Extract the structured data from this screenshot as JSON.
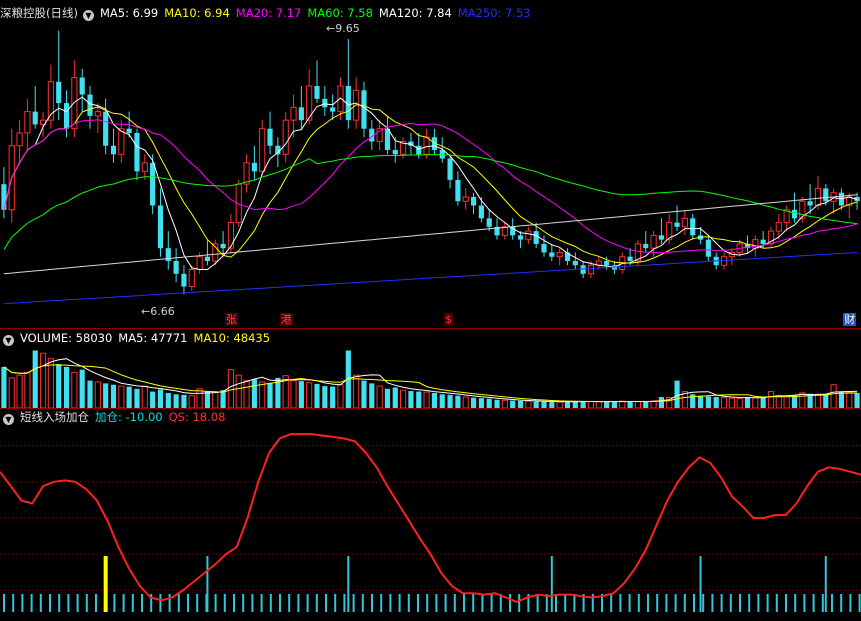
{
  "price_panel": {
    "stock_name": "深粮控股(日线)",
    "ma_labels": [
      {
        "text": "MA5: 6.99",
        "color": "#ffffff"
      },
      {
        "text": "MA10: 6.94",
        "color": "#ffff00"
      },
      {
        "text": "MA20: 7.17",
        "color": "#ff00ff"
      },
      {
        "text": "MA60: 7.58",
        "color": "#00ff00"
      },
      {
        "text": "MA120: 7.84",
        "color": "#ffffff"
      },
      {
        "text": "MA250: 7.53",
        "color": "#2030ff"
      }
    ],
    "high_label": "9.65",
    "low_label": "6.66",
    "event_tags": [
      {
        "text": "张",
        "index": 29,
        "color": "#ff4040"
      },
      {
        "text": "港",
        "index": 36,
        "color": "#ff4040"
      },
      {
        "text": "$",
        "index": 57,
        "color": "#ff3030"
      },
      {
        "text": "财",
        "index": 108,
        "color": "#ffffff"
      }
    ]
  },
  "volume_panel": {
    "ma_labels": [
      {
        "text": "VOLUME: 58030",
        "color": "#ffffff"
      },
      {
        "text": "MA5: 47771",
        "color": "#ffffff"
      },
      {
        "text": "MA10: 48435",
        "color": "#ffff00"
      }
    ]
  },
  "indicator_panel": {
    "name": "短线入场加仓",
    "ma_labels": [
      {
        "text": "加仓: -10.00",
        "color": "#00e0e0"
      },
      {
        "text": "QS: 18.08",
        "color": "#ff3030"
      }
    ]
  },
  "colors": {
    "up": "#ff3030",
    "down": "#40e0f0",
    "grid": "#8a0000"
  },
  "chart_data": [
    {
      "type": "candlestick",
      "title": "深粮控股(日线)",
      "ylim": [
        6.3,
        9.85
      ],
      "ohlc": [
        [
          7.95,
          8.15,
          7.55,
          7.65
        ],
        [
          7.65,
          8.6,
          7.5,
          8.4
        ],
        [
          8.4,
          8.7,
          8.2,
          8.55
        ],
        [
          8.55,
          8.95,
          8.35,
          8.8
        ],
        [
          8.8,
          9.1,
          8.6,
          8.65
        ],
        [
          8.65,
          8.8,
          8.5,
          8.7
        ],
        [
          8.7,
          9.35,
          8.6,
          9.15
        ],
        [
          9.15,
          9.75,
          8.7,
          8.9
        ],
        [
          8.9,
          9.05,
          8.5,
          8.6
        ],
        [
          8.6,
          9.4,
          8.5,
          9.2
        ],
        [
          9.2,
          9.3,
          8.8,
          9.0
        ],
        [
          9.0,
          9.1,
          8.6,
          8.75
        ],
        [
          8.75,
          8.9,
          8.55,
          8.8
        ],
        [
          8.8,
          8.95,
          8.3,
          8.4
        ],
        [
          8.4,
          8.6,
          8.2,
          8.3
        ],
        [
          8.3,
          8.7,
          8.2,
          8.6
        ],
        [
          8.6,
          8.8,
          8.5,
          8.55
        ],
        [
          8.55,
          8.6,
          8.0,
          8.1
        ],
        [
          8.1,
          8.3,
          8.0,
          8.2
        ],
        [
          8.2,
          8.3,
          7.6,
          7.7
        ],
        [
          7.7,
          7.9,
          7.1,
          7.2
        ],
        [
          7.2,
          7.4,
          6.95,
          7.05
        ],
        [
          7.05,
          7.2,
          6.8,
          6.9
        ],
        [
          6.9,
          7.0,
          6.66,
          6.75
        ],
        [
          6.75,
          7.0,
          6.7,
          6.95
        ],
        [
          6.95,
          7.15,
          6.9,
          7.1
        ],
        [
          7.1,
          7.3,
          7.0,
          7.05
        ],
        [
          7.05,
          7.3,
          7.0,
          7.25
        ],
        [
          7.25,
          7.4,
          7.1,
          7.2
        ],
        [
          7.2,
          7.6,
          7.15,
          7.5
        ],
        [
          7.5,
          8.0,
          7.45,
          7.95
        ],
        [
          7.95,
          8.3,
          7.85,
          8.2
        ],
        [
          8.2,
          8.4,
          8.0,
          8.1
        ],
        [
          8.1,
          8.7,
          8.05,
          8.6
        ],
        [
          8.6,
          8.8,
          8.3,
          8.4
        ],
        [
          8.4,
          8.5,
          8.15,
          8.3
        ],
        [
          8.3,
          8.8,
          8.2,
          8.7
        ],
        [
          8.7,
          9.0,
          8.5,
          8.85
        ],
        [
          8.85,
          9.1,
          8.6,
          8.7
        ],
        [
          8.7,
          9.3,
          8.65,
          9.1
        ],
        [
          9.1,
          9.4,
          8.9,
          8.95
        ],
        [
          8.95,
          9.1,
          8.75,
          8.85
        ],
        [
          8.85,
          9.0,
          8.7,
          8.8
        ],
        [
          8.8,
          9.2,
          8.7,
          9.1
        ],
        [
          9.1,
          9.65,
          8.6,
          8.7
        ],
        [
          8.7,
          9.2,
          8.6,
          9.05
        ],
        [
          9.05,
          9.15,
          8.5,
          8.6
        ],
        [
          8.6,
          8.7,
          8.35,
          8.45
        ],
        [
          8.45,
          8.7,
          8.35,
          8.6
        ],
        [
          8.6,
          8.75,
          8.3,
          8.35
        ],
        [
          8.35,
          8.5,
          8.2,
          8.3
        ],
        [
          8.3,
          8.5,
          8.25,
          8.45
        ],
        [
          8.45,
          8.55,
          8.3,
          8.4
        ],
        [
          8.4,
          8.55,
          8.25,
          8.3
        ],
        [
          8.3,
          8.6,
          8.25,
          8.5
        ],
        [
          8.5,
          8.6,
          8.3,
          8.35
        ],
        [
          8.35,
          8.5,
          8.2,
          8.25
        ],
        [
          8.25,
          8.3,
          7.9,
          8.0
        ],
        [
          8.0,
          8.1,
          7.7,
          7.75
        ],
        [
          7.75,
          7.9,
          7.65,
          7.8
        ],
        [
          7.8,
          7.85,
          7.6,
          7.7
        ],
        [
          7.7,
          7.8,
          7.5,
          7.55
        ],
        [
          7.55,
          7.65,
          7.4,
          7.45
        ],
        [
          7.45,
          7.55,
          7.3,
          7.35
        ],
        [
          7.35,
          7.5,
          7.3,
          7.45
        ],
        [
          7.45,
          7.55,
          7.3,
          7.35
        ],
        [
          7.35,
          7.4,
          7.2,
          7.3
        ],
        [
          7.3,
          7.45,
          7.25,
          7.4
        ],
        [
          7.4,
          7.5,
          7.2,
          7.25
        ],
        [
          7.25,
          7.35,
          7.1,
          7.15
        ],
        [
          7.15,
          7.25,
          7.05,
          7.1
        ],
        [
          7.1,
          7.2,
          7.0,
          7.15
        ],
        [
          7.15,
          7.2,
          7.0,
          7.05
        ],
        [
          7.05,
          7.15,
          6.95,
          7.0
        ],
        [
          7.0,
          7.05,
          6.85,
          6.9
        ],
        [
          6.9,
          7.05,
          6.85,
          7.0
        ],
        [
          7.0,
          7.1,
          6.95,
          7.05
        ],
        [
          7.05,
          7.1,
          6.95,
          7.0
        ],
        [
          7.0,
          7.05,
          6.9,
          6.95
        ],
        [
          6.95,
          7.15,
          6.9,
          7.1
        ],
        [
          7.1,
          7.2,
          7.0,
          7.05
        ],
        [
          7.05,
          7.3,
          7.0,
          7.25
        ],
        [
          7.25,
          7.4,
          7.15,
          7.2
        ],
        [
          7.2,
          7.4,
          7.1,
          7.35
        ],
        [
          7.35,
          7.55,
          7.25,
          7.3
        ],
        [
          7.3,
          7.6,
          7.25,
          7.5
        ],
        [
          7.5,
          7.7,
          7.4,
          7.45
        ],
        [
          7.45,
          7.65,
          7.35,
          7.55
        ],
        [
          7.55,
          7.6,
          7.3,
          7.35
        ],
        [
          7.35,
          7.45,
          7.25,
          7.3
        ],
        [
          7.3,
          7.35,
          7.05,
          7.1
        ],
        [
          7.1,
          7.15,
          6.95,
          7.0
        ],
        [
          7.0,
          7.15,
          6.95,
          7.1
        ],
        [
          7.1,
          7.2,
          7.0,
          7.15
        ],
        [
          7.15,
          7.3,
          7.1,
          7.25
        ],
        [
          7.25,
          7.35,
          7.15,
          7.2
        ],
        [
          7.2,
          7.35,
          7.1,
          7.3
        ],
        [
          7.3,
          7.4,
          7.2,
          7.25
        ],
        [
          7.25,
          7.45,
          7.2,
          7.4
        ],
        [
          7.4,
          7.6,
          7.3,
          7.5
        ],
        [
          7.5,
          7.7,
          7.4,
          7.65
        ],
        [
          7.65,
          7.85,
          7.5,
          7.55
        ],
        [
          7.55,
          7.8,
          7.5,
          7.75
        ],
        [
          7.75,
          7.95,
          7.6,
          7.7
        ],
        [
          7.7,
          8.05,
          7.65,
          7.9
        ],
        [
          7.9,
          7.95,
          7.7,
          7.75
        ],
        [
          7.75,
          7.9,
          7.6,
          7.85
        ],
        [
          7.85,
          7.9,
          7.65,
          7.7
        ],
        [
          7.7,
          7.85,
          7.55,
          7.8
        ],
        [
          7.8,
          7.85,
          7.65,
          7.75
        ]
      ]
    },
    {
      "type": "bar",
      "title": "VOLUME",
      "ylim": [
        0,
        230000
      ],
      "values": [
        150000,
        110000,
        120000,
        130000,
        210000,
        200000,
        180000,
        160000,
        150000,
        130000,
        140000,
        100000,
        95000,
        90000,
        85000,
        80000,
        78000,
        70000,
        80000,
        60000,
        68000,
        55000,
        50000,
        48000,
        45000,
        70000,
        60000,
        58000,
        65000,
        140000,
        120000,
        100000,
        105000,
        95000,
        90000,
        110000,
        118000,
        100000,
        98000,
        92000,
        88000,
        80000,
        78000,
        85000,
        210000,
        120000,
        100000,
        90000,
        80000,
        70000,
        75000,
        65000,
        62000,
        60000,
        58000,
        55000,
        50000,
        48000,
        45000,
        40000,
        38000,
        36000,
        34000,
        30000,
        28000,
        27000,
        26000,
        25000,
        24000,
        23000,
        22000,
        22000,
        24000,
        23000,
        25000,
        24000,
        23000,
        22000,
        24000,
        25000,
        24000,
        23000,
        22000,
        26000,
        40000,
        38000,
        100000,
        60000,
        50000,
        45000,
        42000,
        40000,
        38000,
        36000,
        35000,
        40000,
        38000,
        37000,
        60000,
        45000,
        42000,
        48000,
        55000,
        52000,
        50000,
        48000,
        85000,
        60000,
        58030,
        55000
      ]
    },
    {
      "type": "line",
      "title": "短线入场加仓",
      "ylim": [
        -15,
        115
      ],
      "series": [
        {
          "name": "QS",
          "values": [
            82,
            72,
            62,
            60,
            72,
            75,
            76,
            75,
            70,
            62,
            48,
            30,
            15,
            3,
            -5,
            -7,
            -5,
            0,
            6,
            12,
            18,
            25,
            30,
            50,
            75,
            95,
            105,
            108,
            108,
            108,
            107,
            106,
            105,
            103,
            95,
            85,
            72,
            60,
            48,
            36,
            25,
            12,
            3,
            -2,
            -2,
            -3,
            -2,
            -5,
            -8,
            -5,
            -3,
            -4,
            -3,
            -3,
            -4,
            -5,
            -4,
            -2,
            5,
            15,
            28,
            45,
            62,
            75,
            85,
            92,
            88,
            78,
            65,
            58,
            50,
            50,
            52,
            52,
            60,
            72,
            82,
            85,
            84,
            82,
            80
          ]
        }
      ],
      "signals": {
        "name": "加仓",
        "values": [
          13,
          26,
          44,
          70,
          89,
          105
        ]
      }
    }
  ]
}
